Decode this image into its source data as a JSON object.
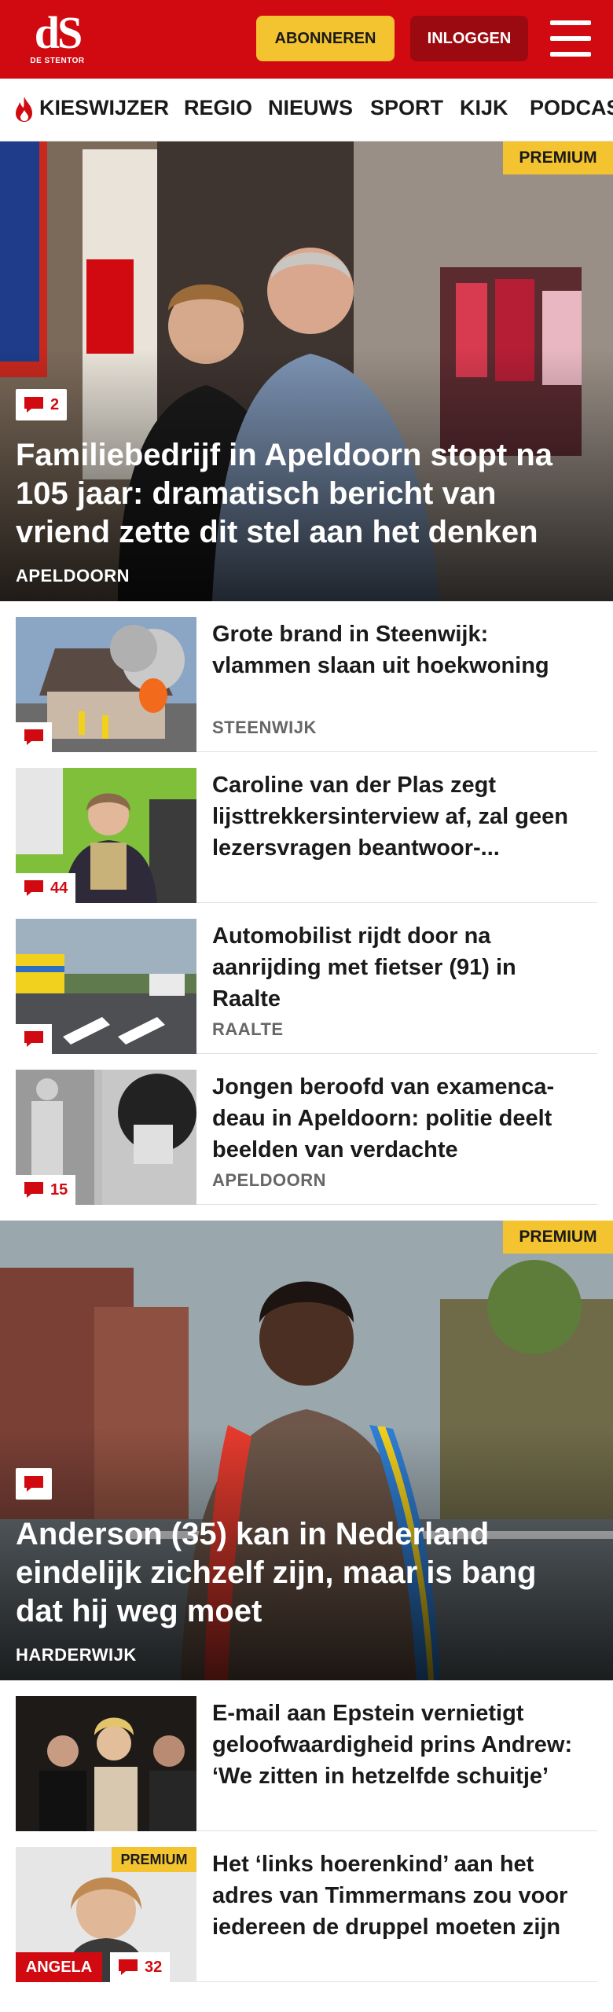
{
  "header": {
    "logo_text": "dS",
    "logo_sub": "DE STENTOR",
    "subscribe_label": "ABONNEREN",
    "login_label": "INLOGGEN",
    "brand_color": "#d10a11",
    "accent_color": "#f4c430"
  },
  "nav": {
    "items": [
      "KIESWIJZER",
      "REGIO",
      "NIEUWS",
      "SPORT",
      "KIJK",
      "PODCAST"
    ]
  },
  "articles": [
    {
      "type": "hero",
      "premium": "PREMIUM",
      "comments": "2",
      "title": "Familiebedrijf in Apeldoorn stopt na 105 jaar: dramatisch bericht van vriend zette dit stel aan het denken",
      "location": "APELDOORN"
    },
    {
      "type": "list",
      "comments": "",
      "title": "Grote brand in Steenwijk: vlammen slaan uit hoekwoning",
      "location": "STEENWIJK"
    },
    {
      "type": "list",
      "comments": "44",
      "title": "Caroline van der Plas zegt lijsttrekkersinterview af, zal geen lezersvragen beantwoor-...",
      "location": ""
    },
    {
      "type": "list",
      "comments": "",
      "title": "Automobilist rijdt door na aanrijding met fietser (91) in Raalte",
      "location": "RAALTE"
    },
    {
      "type": "list",
      "comments": "15",
      "title": "Jongen beroofd van examenca­deau in Apeldoorn: politie deelt beelden van verdachte",
      "location": "APELDOORN"
    },
    {
      "type": "hero",
      "premium": "PREMIUM",
      "comments": "",
      "title": "Anderson (35) kan in Nederland eindelijk zichzelf zijn, maar is bang dat hij weg moet",
      "location": "HARDERWIJK"
    },
    {
      "type": "list",
      "comments": "",
      "title": "E-mail aan Epstein vernietigt geloofwaardigheid prins Andrew: ‘We zitten in hetzelfde schuitje’",
      "location": ""
    },
    {
      "type": "list",
      "premium": "PREMIUM",
      "label": "ANGELA",
      "comments": "32",
      "title": "Het ‘links hoerenkind’ aan het adres van Timmermans zou voor iedereen de druppel moeten zijn",
      "location": ""
    }
  ]
}
